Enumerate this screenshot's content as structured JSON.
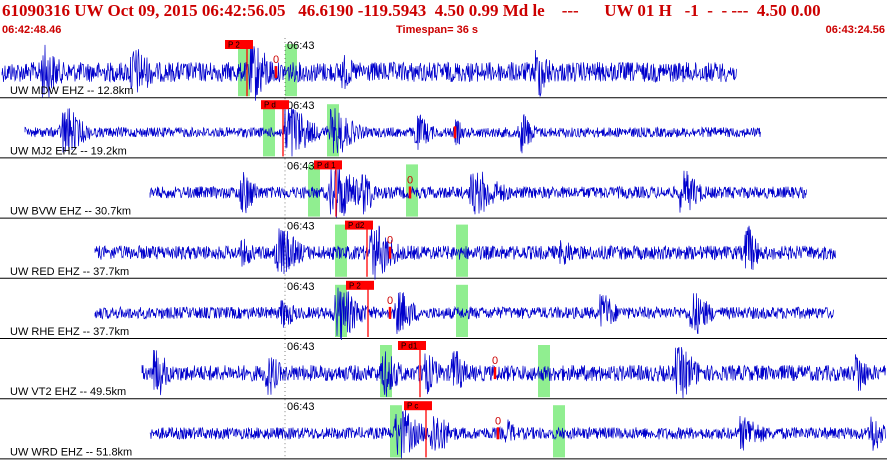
{
  "header": {
    "title": "61090316 UW Oct 09, 2015 06:42:56.05   46.6190 -119.5943  4.50 0.99 Md le    ---      UW 01 H   -1  -  - ---  4.50 0.00",
    "start_time": "06:42:48.46",
    "timespan": "Timespan=  36 s",
    "end_time": "06:43:24.56"
  },
  "colors": {
    "trace": "#0000cc",
    "pick": "#ff0000",
    "window": "#90ee90",
    "text_header": "#cc0000"
  },
  "minute_mark": "06:43",
  "traces": [
    {
      "label": "UW MDW EHZ -- 12.8km",
      "pick": "P 2",
      "zero": "0"
    },
    {
      "label": "UW MJ2 EHZ -- 19.2km",
      "pick": "P d",
      "zero": ""
    },
    {
      "label": "UW BVW EHZ -- 30.7km",
      "pick": "P d 1",
      "zero": "0"
    },
    {
      "label": "UW RED EHZ -- 37.7km",
      "pick": "P d2",
      "zero": "0"
    },
    {
      "label": "UW RHE EHZ -- 37.7km",
      "pick": "P 2",
      "zero": "0"
    },
    {
      "label": "UW VT2 EHZ -- 49.5km",
      "pick": "P d1",
      "zero": "0"
    },
    {
      "label": "UW WRD EHZ -- 51.8km",
      "pick": "P c",
      "zero": "0"
    }
  ]
}
